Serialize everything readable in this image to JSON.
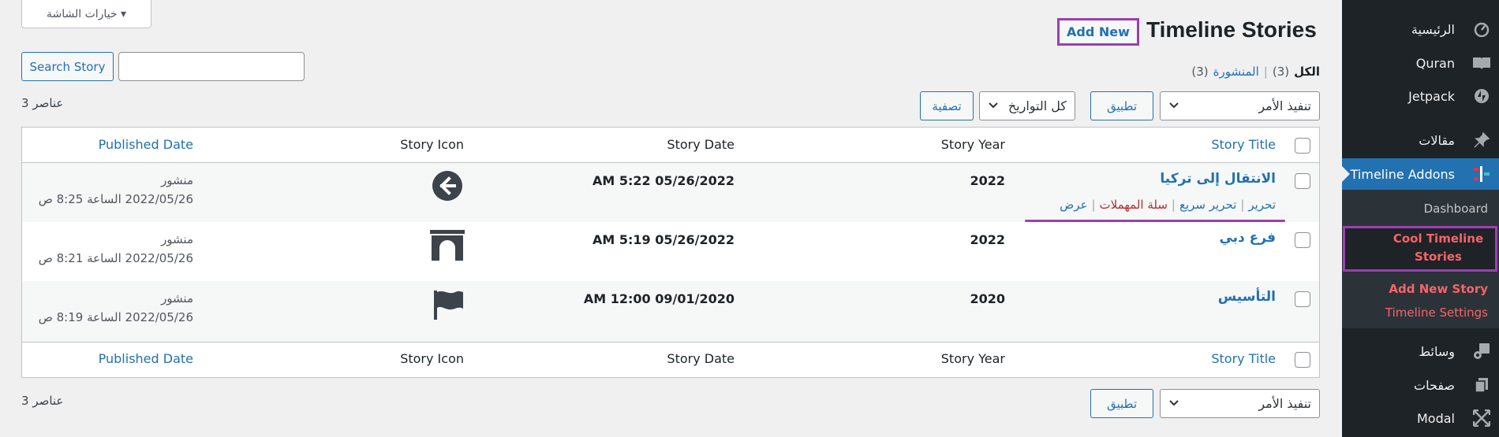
{
  "screen_options": "خيارات الشاشة ▾",
  "page": {
    "title": "Timeline Stories",
    "add_new": "Add New"
  },
  "search": {
    "button": "Search Story",
    "placeholder": ""
  },
  "views": {
    "all_label": "الكل",
    "all_count": "(3)",
    "published_label": "المنشورة",
    "published_count": "(3)",
    "separator": "|"
  },
  "items_count": "3 عناصر",
  "bulk": {
    "action": "تنفيذ الأمر",
    "apply": "تطبيق",
    "dates": "كل التواريخ",
    "filter": "تصفية"
  },
  "columns": {
    "title": "Story Title",
    "year": "Story Year",
    "date": "Story Date",
    "icon": "Story Icon",
    "published": "Published Date"
  },
  "rows": [
    {
      "title": "الانتقال إلى تركيا",
      "year": "2022",
      "date": "AM 5:22 05/26/2022",
      "icon": "arrow-left-circle-icon",
      "status": "منشور",
      "published": "2022/05/26 الساعة 8:25 ص"
    },
    {
      "title": "فرع دبي",
      "year": "2022",
      "date": "AM 5:19 05/26/2022",
      "icon": "archway-icon",
      "status": "منشور",
      "published": "2022/05/26 الساعة 8:21 ص"
    },
    {
      "title": "التأسيس",
      "year": "2020",
      "date": "AM 12:00 09/01/2020",
      "icon": "flag-icon",
      "status": "منشور",
      "published": "2022/05/26 الساعة 8:19 ص"
    }
  ],
  "row_actions": {
    "edit": "تحرير",
    "quick_edit": "تحرير سريع",
    "trash": "سلة المهملات",
    "view": "عرض"
  },
  "sidebar": {
    "items": [
      {
        "label": "الرئيسية",
        "icon": "dashboard-icon"
      },
      {
        "label": "Quran",
        "icon": "book-icon"
      },
      {
        "label": "Jetpack",
        "icon": "jetpack-icon"
      },
      {
        "label": "مقالات",
        "icon": "pin-icon"
      },
      {
        "label": "Timeline Addons",
        "icon": "timeline-icon"
      },
      {
        "label": "وسائط",
        "icon": "media-icon"
      },
      {
        "label": "صفحات",
        "icon": "page-icon"
      },
      {
        "label": "Modal",
        "icon": "move-icon"
      }
    ],
    "submenu": {
      "dashboard": "Dashboard",
      "cool_line1": "Cool Timeline",
      "cool_line2": "Stories",
      "add_new": "Add New Story",
      "settings": "Timeline Settings"
    }
  },
  "colors": {
    "accent": "#2271b1",
    "sidebar": "#1d2327",
    "highlight": "#9b3fb0",
    "submenu_active": "#f86368"
  }
}
